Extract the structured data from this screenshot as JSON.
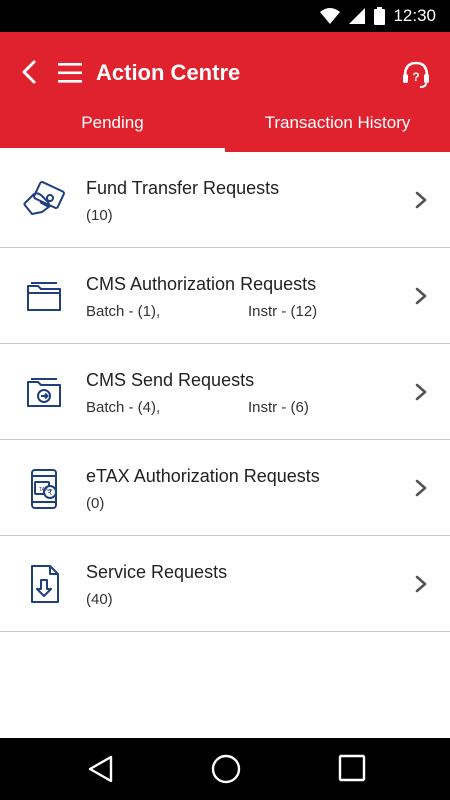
{
  "status_bar": {
    "time": "12:30"
  },
  "header": {
    "title": "Action Centre"
  },
  "tabs": [
    {
      "label": "Pending",
      "active": true
    },
    {
      "label": "Transaction History",
      "active": false
    }
  ],
  "items": [
    {
      "title": "Fund Transfer Requests",
      "sub": "(10)",
      "sub2": "",
      "icon": "hand-card-icon"
    },
    {
      "title": "CMS Authorization Requests",
      "sub": "Batch - (1),",
      "sub2": "Instr - (12)",
      "icon": "folder-icon"
    },
    {
      "title": "CMS Send Requests",
      "sub": "Batch - (4),",
      "sub2": "Instr - (6)",
      "icon": "folder-send-icon"
    },
    {
      "title": "eTAX Authorization Requests",
      "sub": "(0)",
      "sub2": "",
      "icon": "phone-tax-icon"
    },
    {
      "title": "Service Requests",
      "sub": "(40)",
      "sub2": "",
      "icon": "download-document-icon"
    }
  ],
  "colors": {
    "brand": "#e0222e",
    "icon": "#1f3f7f",
    "divider": "#c9c9c9"
  }
}
